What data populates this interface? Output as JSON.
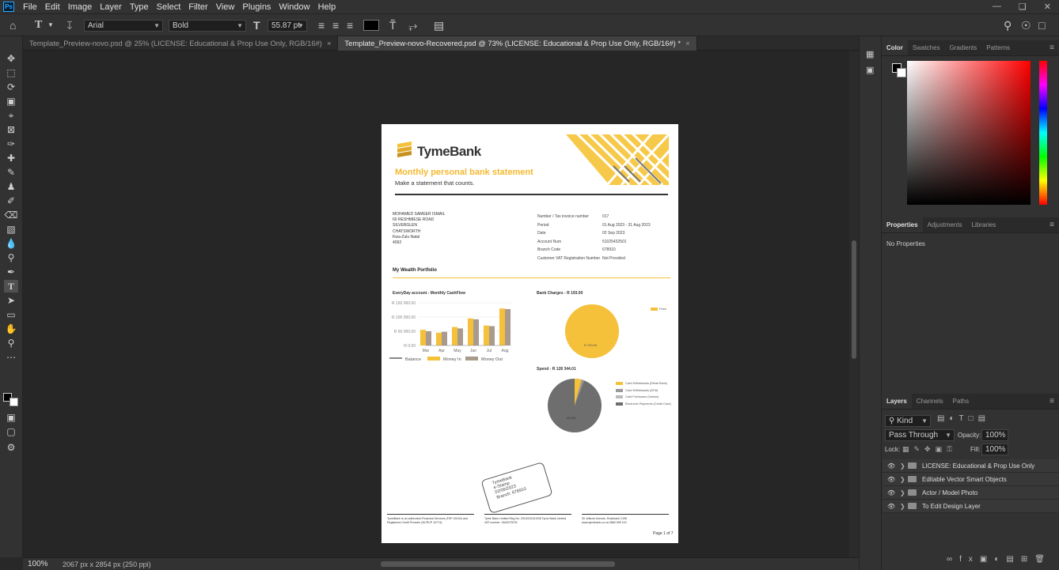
{
  "app": {
    "menu": [
      "File",
      "Edit",
      "Image",
      "Layer",
      "Type",
      "Select",
      "Filter",
      "View",
      "Plugins",
      "Window",
      "Help"
    ]
  },
  "options_bar": {
    "font_family": "Arial",
    "font_style": "Bold",
    "font_size": "55.87 pt"
  },
  "tabs": [
    {
      "label": "Template_Preview-novo.psd @ 25% (LICENSE: Educational & Prop Use Only, RGB/16#)",
      "active": false
    },
    {
      "label": "Template_Preview-novo-Recovered.psd @ 73% (LICENSE: Educational & Prop Use Only, RGB/16#) *",
      "active": true
    }
  ],
  "status": {
    "zoom": "100%",
    "dimensions": "2067 px x 2854 px (250 ppi)"
  },
  "color_panel": {
    "tabs": [
      "Color",
      "Swatches",
      "Gradients",
      "Patterns"
    ]
  },
  "properties_panel": {
    "tabs": [
      "Properties",
      "Adjustments",
      "Libraries"
    ],
    "message": "No Properties"
  },
  "layers_panel": {
    "tabs": [
      "Layers",
      "Channels",
      "Paths"
    ],
    "filter_kind": "Kind",
    "blend_mode": "Pass Through",
    "opacity_label": "Opacity:",
    "opacity": "100%",
    "lock_label": "Lock:",
    "fill_label": "Fill:",
    "fill": "100%",
    "layers": [
      "LICENSE: Educational & Prop Use Only",
      "Editable Vector Smart Objects",
      "Actor / Model Photo",
      "To Edit Design Layer"
    ]
  },
  "document": {
    "brand": "TymeBank",
    "heading": "Monthly personal bank statement",
    "tagline": "Make a statement that counts.",
    "address": [
      "MOHAMED SAMEER ISMAIL",
      "60 RESHMIESE ROAD",
      "SILVERGLEN",
      "CHATSWORTH",
      "Kwa-Zulu Natal",
      "4092"
    ],
    "details": [
      {
        "label": "Number / Tax invoice number",
        "value": "017"
      },
      {
        "label": "Period",
        "value": "01 Aug 2023 - 31 Aug 2023"
      },
      {
        "label": "Date",
        "value": "02 Sep 2023"
      },
      {
        "label": "Account Num",
        "value": "51025432501"
      },
      {
        "label": "Branch Code",
        "value": "678910"
      },
      {
        "label": "Customer VAT Registration Number",
        "value": "Not Provided"
      }
    ],
    "section_title": "My Wealth Portfolio",
    "bank_charges_title": "Bank Charges - R 193.00",
    "bank_charges_legend": "Fees",
    "bank_charges_value": "R 193.00",
    "spend_title": "Spend - R 128 344.01",
    "spend_legend": [
      "Card Withdrawals (Retail Bank)",
      "Card Withdrawals (ATM)",
      "Card Purchases (Values)",
      "Electronic Payments (Credit Card)"
    ],
    "spend_center_value": "95.0%",
    "stamp": [
      "TymeBank",
      "e-Stamp",
      "02/09/2023",
      "Branch: 678910"
    ],
    "footer": [
      "TymeBank is an authorised Financial Services (FSP 49140) and Registered Credit Provider (NCRCP 10774)",
      "Tyme Bank Limited Reg No: 2015/231510/06  Tyme Bank Limited VAT number: 4540273078",
      "30 Jellicoe Avenue, Rosebank 2196  www.tymebank.co.za  0860 999 119"
    ],
    "page": "Page 1 of 7"
  },
  "chart_data": {
    "type": "bar",
    "title": "EveryDay account - Monthly CashFlow",
    "categories": [
      "Mar",
      "Apr",
      "May",
      "Jun",
      "Jul",
      "Aug"
    ],
    "yticks": [
      "R 150 000.00",
      "R 100 000.00",
      "R 50 000.00",
      "R 0.00"
    ],
    "ylim": [
      0,
      150000
    ],
    "series": [
      {
        "name": "Balance",
        "color": "#888888",
        "values": [
          0,
          0,
          0,
          0,
          0,
          0
        ]
      },
      {
        "name": "Money In",
        "color": "#f5c03a",
        "values": [
          55000,
          45000,
          65000,
          95000,
          70000,
          130000
        ]
      },
      {
        "name": "Money Out",
        "color": "#a89a8c",
        "values": [
          50000,
          48000,
          60000,
          92000,
          68000,
          128000
        ]
      }
    ],
    "legend": "bottom"
  }
}
